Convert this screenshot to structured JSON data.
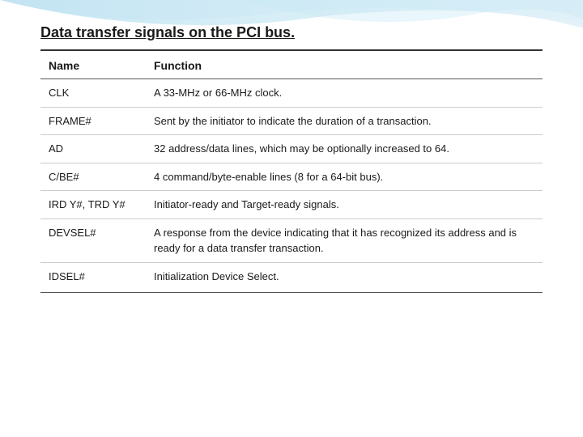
{
  "page": {
    "title": "Data transfer signals on the PCI bus.",
    "table": {
      "headers": {
        "name": "Name",
        "function": "Function"
      },
      "rows": [
        {
          "name": "CLK",
          "function": "A  33-MHz   or  66-MHz    clock."
        },
        {
          "name": "FRAME#",
          "function": "Sent  by  the  initiator   to  indicate   the  duration   of  a transaction."
        },
        {
          "name": "AD",
          "function": "32  address/data   lines,   which    may  be  optionally increased  to  64."
        },
        {
          "name": "C/BE#",
          "function": "4  command/byte-enable    lines  (8  for   a  64-bit   bus)."
        },
        {
          "name": "IRD Y#,   TRD Y#",
          "function": "Initiator-ready    and    Target-ready  signals."
        },
        {
          "name": "DEVSEL#",
          "function": "A  response  from   the  device   indicating   that   it  has recognized   its  address  and  is  ready   for   a  data transfer   transaction."
        },
        {
          "name": "IDSEL#",
          "function": "Initialization      Device   Select."
        }
      ]
    }
  }
}
